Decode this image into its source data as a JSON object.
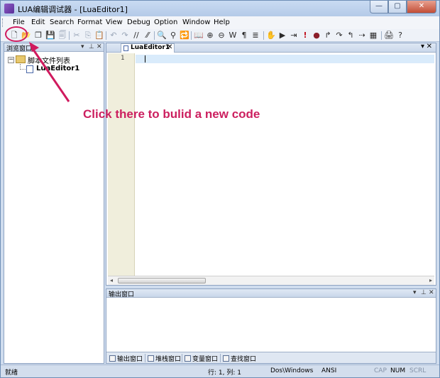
{
  "window": {
    "title": "LUA编辑调试器 - [LuaEditor1]",
    "minimize_glyph": "—",
    "maximize_glyph": "▢",
    "close_glyph": "✕"
  },
  "menu": [
    "File",
    "Edit",
    "Search",
    "Format",
    "View",
    "Debug",
    "Option",
    "Window",
    "Help"
  ],
  "toolbar": {
    "icons": [
      "new-file-icon",
      "open-file-icon",
      "copy-file-icon",
      "save-icon",
      "save-all-icon",
      "cut-icon",
      "copy-icon",
      "paste-icon",
      "undo-icon",
      "redo-icon",
      "comment-icon",
      "uncomment-icon",
      "find-icon",
      "find-next-icon",
      "replace-icon",
      "bookmark-icon",
      "zoom-in-icon",
      "zoom-out-icon",
      "word-wrap-icon",
      "pilcrow-icon",
      "indent-icon",
      "hand-icon",
      "run-icon",
      "step-icon",
      "stop-icon",
      "breakpoint-icon",
      "step-into-icon",
      "step-over-icon",
      "step-out-icon",
      "run-to-cursor-icon",
      "watch-icon",
      "print-icon",
      "help-icon"
    ],
    "glyphs": [
      "🗋",
      "📂",
      "❐",
      "💾",
      "🗐",
      "✂",
      "⎘",
      "📋",
      "↶",
      "↷",
      "//",
      "⁄⁄",
      "🔍",
      "⚲",
      "🔁",
      "📖",
      "⊕",
      "⊖",
      "W",
      "¶",
      "≣",
      "✋",
      "▶",
      "⇥",
      "!",
      "●",
      "↱",
      "↷",
      "↰",
      "⇢",
      "▦",
      "🖨",
      "?"
    ]
  },
  "left_panel": {
    "title": "浏览窗口",
    "tree_root": "脚本文件列表",
    "tree_child": "LuaEditor1",
    "expander": "−",
    "dropdown_glyph": "▾",
    "pin_glyph": "⊥",
    "close_glyph": "✕"
  },
  "editor": {
    "tab_label": "LuaEditor1",
    "tab_close": "✕",
    "tab_menu_glyph": "▾",
    "tab_close_glyph": "✕",
    "line_numbers": [
      "1"
    ],
    "scroll_left": "◂",
    "scroll_right": "▸"
  },
  "output_panel": {
    "title": "输出窗口",
    "tabs": [
      "输出窗口",
      "堆栈窗口",
      "变量窗口",
      "查找窗口"
    ]
  },
  "status": {
    "ready": "就绪",
    "position": "行: 1, 列: 1",
    "line_ending": "Dos\\Windows",
    "encoding": "ANSI",
    "cap": "CAP",
    "num": "NUM",
    "scrl": "SCRL"
  },
  "annotation": {
    "text": "Click there to bulid a new code",
    "color": "#cc1f5f"
  }
}
